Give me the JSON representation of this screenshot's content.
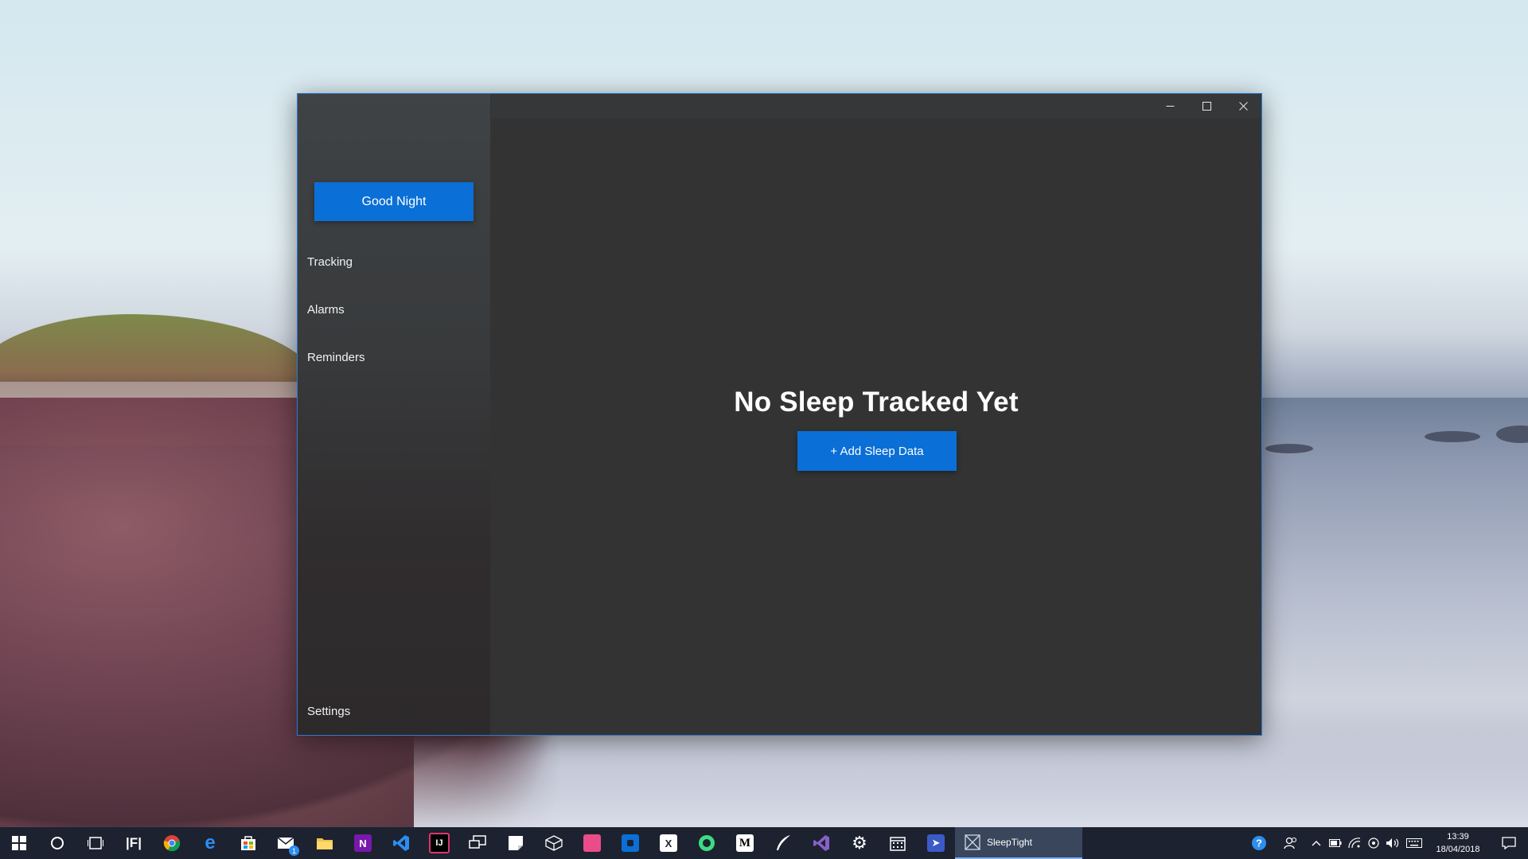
{
  "window": {
    "controls": {
      "minimize": "minimize",
      "maximize": "maximize",
      "close": "close"
    }
  },
  "sidebar": {
    "primary_button": "Good Night",
    "items": [
      {
        "label": "Tracking"
      },
      {
        "label": "Alarms"
      },
      {
        "label": "Reminders"
      }
    ],
    "settings_label": "Settings"
  },
  "main": {
    "empty_title": "No Sleep Tracked Yet",
    "add_button": "+ Add Sleep Data"
  },
  "taskbar": {
    "pinned_icons": [
      "windows-start-icon",
      "cortana-search-icon",
      "task-view-icon",
      "fl-studio-icon",
      "chrome-icon",
      "edge-icon",
      "store-icon",
      "mail-icon",
      "file-explorer-icon",
      "onenote-icon",
      "vscode-icon",
      "intellij-icon",
      "remote-desktop-icon",
      "sticky-notes-icon",
      "3d-viewer-icon",
      "dribbble-icon",
      "app-blue-icon",
      "excel-icon",
      "android-studio-icon",
      "medium-icon",
      "quill-icon",
      "visual-studio-icon",
      "settings-icon",
      "calendar-icon",
      "paper-plane-icon"
    ],
    "fl_label": "|F|",
    "medium_label": "M",
    "active_app": "SleepTight",
    "mail_badge": "1",
    "time": "13:39",
    "date": "18/04/2018"
  },
  "colors": {
    "accent": "#0A6FD6",
    "window_border": "#2D7AD3",
    "content_bg": "#333333",
    "taskbar_bg": "#1D2230"
  }
}
